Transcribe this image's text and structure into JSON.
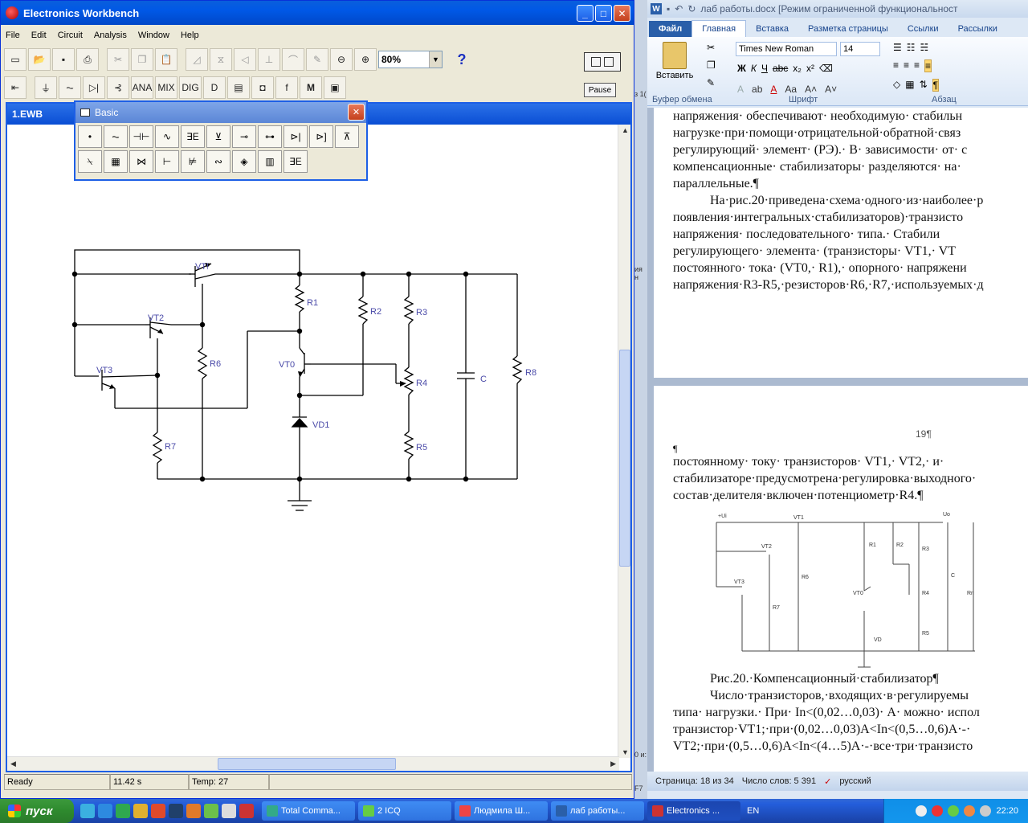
{
  "ewb": {
    "title": "Electronics Workbench",
    "menu": [
      "File",
      "Edit",
      "Circuit",
      "Analysis",
      "Window",
      "Help"
    ],
    "zoom": "80%",
    "pause_label": "Pause",
    "circuit_title": "1.EWB",
    "basic_title": "Basic",
    "status": {
      "ready": "Ready",
      "time": "11.42 s",
      "temp": "Temp:  27"
    },
    "component_labels": [
      "VT!",
      "VT2",
      "VT3",
      "VT0",
      "VD1",
      "R1",
      "R2",
      "R3",
      "R4",
      "R5",
      "R6",
      "R7",
      "R8",
      "C"
    ]
  },
  "word": {
    "title": "лаб работы.docx [Режим ограниченной функциональност",
    "tabs": [
      "Файл",
      "Главная",
      "Вставка",
      "Разметка страницы",
      "Ссылки",
      "Рассылки"
    ],
    "paste_label": "Вставить",
    "font_name": "Times New Roman",
    "font_size": "14",
    "groups": [
      "Буфер обмена",
      "Шрифт",
      "Абзац"
    ],
    "page1_lines": [
      "напряжения· обеспечивают· необходимую· стабильн",
      "нагрузке·при·помощи·отрицательной·обратной·связ",
      "регулирующий· элемент· (РЭ).· В· зависимости· от· с",
      "компенсационные· стабилизаторы· разделяются· на·",
      "параллельные.¶",
      "На·рис.20·приведена·схема·одного·из·наиболее·р",
      "появления·интегральных·стабилизаторов)·транзисто",
      "напряжения· последовательного· типа.· Стабили",
      "регулирующего· элемента· (транзисторы· VT1,· VT",
      "постоянного· тока· (VT0,· R1),· опорного· напряжени",
      "напряжения·R3-R5,·резисторов·R6,·R7,·используемых·д"
    ],
    "page_number": "19¶",
    "pilcrow": "¶",
    "page2_lines": [
      "постоянному· току· транзисторов· VT1,· VT2,· и·",
      "стабилизаторе·предусмотрена·регулировка·выходного·",
      "состав·делителя·включен·потенциометр·R4.¶"
    ],
    "figure_labels": [
      "+Ui",
      "VT1",
      "Uo",
      "VT2",
      "R1",
      "R2",
      "R3",
      "VT3",
      "R6",
      "VT0",
      "R4",
      "C",
      "Rn",
      "R7",
      "VD",
      "R5"
    ],
    "caption": "Рис.20.·Компенсационный·стабилизатор¶",
    "page2_after": [
      "Число·транзисторов,·входящих·в·регулируемы",
      "типа· нагрузки.· При· In<(0,02…0,03)· А· можно· испол",
      "транзистор·VT1;·при·(0,02…0,03)А<In<(0,5…0,6)А·-·",
      "VT2;·при·(0,5…0,6)А<In<(4…5)А·-·все·три·транзисто"
    ],
    "status": {
      "page": "Страница: 18 из 34",
      "words": "Число слов: 5 391",
      "lang": "русский"
    }
  },
  "behind": {
    "t1": "з 1(",
    "t2": "ия н",
    "t3": "0 и:",
    "t4": "F7"
  },
  "taskbar": {
    "start": "пуск",
    "tasks": [
      "Total Comma...",
      "2 ICQ",
      "Людмила Ш...",
      "лаб работы...",
      "Electronics ..."
    ],
    "lang": "EN",
    "clock": "22:20"
  }
}
